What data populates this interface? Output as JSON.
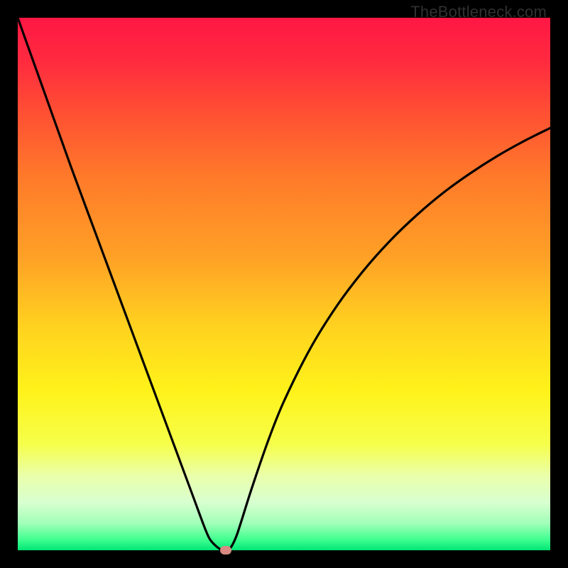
{
  "watermark": "TheBottleneck.com",
  "chart_data": {
    "type": "line",
    "title": "",
    "xlabel": "",
    "ylabel": "",
    "xlim": [
      0,
      100
    ],
    "ylim": [
      0,
      100
    ],
    "background_gradient": {
      "stops": [
        {
          "offset": 0.0,
          "color": "#ff1744"
        },
        {
          "offset": 0.08,
          "color": "#ff2a3f"
        },
        {
          "offset": 0.18,
          "color": "#ff5033"
        },
        {
          "offset": 0.3,
          "color": "#ff7a2a"
        },
        {
          "offset": 0.45,
          "color": "#ffa126"
        },
        {
          "offset": 0.58,
          "color": "#ffd21f"
        },
        {
          "offset": 0.7,
          "color": "#fff21a"
        },
        {
          "offset": 0.8,
          "color": "#f6ff4a"
        },
        {
          "offset": 0.86,
          "color": "#eaffaa"
        },
        {
          "offset": 0.91,
          "color": "#d8ffd0"
        },
        {
          "offset": 0.95,
          "color": "#a0ffb8"
        },
        {
          "offset": 0.98,
          "color": "#40ff90"
        },
        {
          "offset": 1.0,
          "color": "#00e676"
        }
      ]
    },
    "series": [
      {
        "name": "bottleneck-curve",
        "color": "#000000",
        "x": [
          0,
          5,
          10,
          15,
          20,
          25,
          28,
          31,
          33,
          35,
          36,
          37,
          38,
          38.7,
          39.3,
          40,
          41,
          42,
          44,
          47,
          50,
          55,
          60,
          65,
          70,
          75,
          80,
          85,
          90,
          95,
          100
        ],
        "y": [
          100,
          86,
          72,
          58.5,
          45,
          31.5,
          23.4,
          15.3,
          9.9,
          4.5,
          2.2,
          1.0,
          0.2,
          0.0,
          0.0,
          0.5,
          2.5,
          5.5,
          11.8,
          20.5,
          28.0,
          38.0,
          46.0,
          52.6,
          58.2,
          63.0,
          67.2,
          70.8,
          74.0,
          76.8,
          79.3
        ]
      }
    ],
    "marker": {
      "x": 39,
      "y": 0,
      "color": "#d98a82"
    },
    "grid": false,
    "axes_visible": false
  }
}
